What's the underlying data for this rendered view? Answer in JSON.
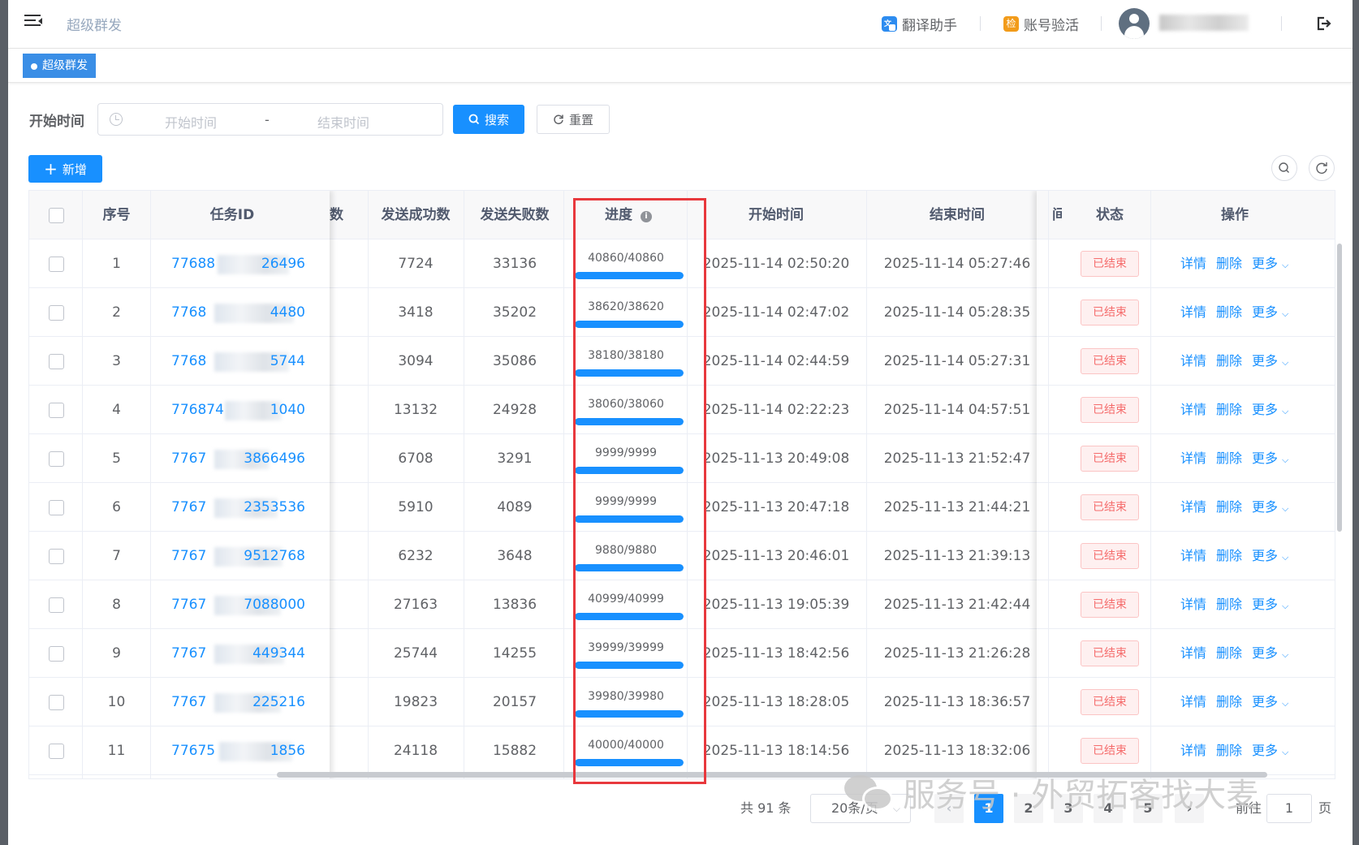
{
  "header": {
    "crumb": "超级群发",
    "translate": "翻译助手",
    "verify": "账号验活",
    "verify_badge": "检"
  },
  "tags": {
    "active": "超级群发"
  },
  "filter": {
    "label": "开始时间",
    "start_placeholder": "开始时间",
    "separator": "-",
    "end_placeholder": "结束时间",
    "search": "搜索",
    "reset": "重置",
    "add": "新增"
  },
  "columns": {
    "index": "序号",
    "task_id": "任务ID",
    "partial": "数",
    "success": "发送成功数",
    "fail": "发送失败数",
    "progress": "进度",
    "start": "开始时间",
    "end": "结束时间",
    "partial2": "间",
    "status": "状态",
    "ops": "操作"
  },
  "ops": {
    "detail": "详情",
    "delete": "删除",
    "more": "更多"
  },
  "rows": [
    {
      "no": "1",
      "id_head": "77688",
      "id_tail": "26496",
      "success": "7724",
      "fail": "33136",
      "progress": "40860/40860",
      "pct": 1,
      "start": "2025-11-14 02:50:20",
      "end": "2025-11-14 05:27:46",
      "status": "已结束"
    },
    {
      "no": "2",
      "id_head": "7768",
      "id_tail": "4480",
      "success": "3418",
      "fail": "35202",
      "progress": "38620/38620",
      "pct": 1,
      "start": "2025-11-14 02:47:02",
      "end": "2025-11-14 05:28:35",
      "status": "已结束"
    },
    {
      "no": "3",
      "id_head": "7768",
      "id_tail": "5744",
      "success": "3094",
      "fail": "35086",
      "progress": "38180/38180",
      "pct": 1,
      "start": "2025-11-14 02:44:59",
      "end": "2025-11-14 05:27:31",
      "status": "已结束"
    },
    {
      "no": "4",
      "id_head": "776874",
      "id_tail": "1040",
      "success": "13132",
      "fail": "24928",
      "progress": "38060/38060",
      "pct": 1,
      "start": "2025-11-14 02:22:23",
      "end": "2025-11-14 04:57:51",
      "status": "已结束"
    },
    {
      "no": "5",
      "id_head": "7767",
      "id_tail": "3866496",
      "success": "6708",
      "fail": "3291",
      "progress": "9999/9999",
      "pct": 1,
      "start": "2025-11-13 20:49:08",
      "end": "2025-11-13 21:52:47",
      "status": "已结束"
    },
    {
      "no": "6",
      "id_head": "7767",
      "id_tail": "2353536",
      "success": "5910",
      "fail": "4089",
      "progress": "9999/9999",
      "pct": 1,
      "start": "2025-11-13 20:47:18",
      "end": "2025-11-13 21:44:21",
      "status": "已结束"
    },
    {
      "no": "7",
      "id_head": "7767",
      "id_tail": "9512768",
      "success": "6232",
      "fail": "3648",
      "progress": "9880/9880",
      "pct": 1,
      "start": "2025-11-13 20:46:01",
      "end": "2025-11-13 21:39:13",
      "status": "已结束"
    },
    {
      "no": "8",
      "id_head": "7767",
      "id_tail": "7088000",
      "success": "27163",
      "fail": "13836",
      "progress": "40999/40999",
      "pct": 1,
      "start": "2025-11-13 19:05:39",
      "end": "2025-11-13 21:42:44",
      "status": "已结束"
    },
    {
      "no": "9",
      "id_head": "7767",
      "id_tail": "449344",
      "success": "25744",
      "fail": "14255",
      "progress": "39999/39999",
      "pct": 1,
      "start": "2025-11-13 18:42:56",
      "end": "2025-11-13 21:26:28",
      "status": "已结束"
    },
    {
      "no": "10",
      "id_head": "7767",
      "id_tail": "225216",
      "success": "19823",
      "fail": "20157",
      "progress": "39980/39980",
      "pct": 1,
      "start": "2025-11-13 18:28:05",
      "end": "2025-11-13 18:36:57",
      "status": "已结束"
    },
    {
      "no": "11",
      "id_head": "77675",
      "id_tail": "1856",
      "success": "24118",
      "fail": "15882",
      "progress": "40000/40000",
      "pct": 1,
      "start": "2025-11-13 18:14:56",
      "end": "2025-11-13 18:32:06",
      "status": "已结束"
    }
  ],
  "pagination": {
    "total": "共 91 条",
    "size": "20条/页",
    "pages": [
      "1",
      "2",
      "3",
      "4",
      "5"
    ],
    "goto": "前往",
    "goto_value": "1",
    "page_unit": "页"
  },
  "watermark": "服务号 · 外贸拓客找大麦",
  "colors": {
    "primary": "#1890ff",
    "danger": "#f56c6c",
    "highlight": "#e8383d"
  }
}
